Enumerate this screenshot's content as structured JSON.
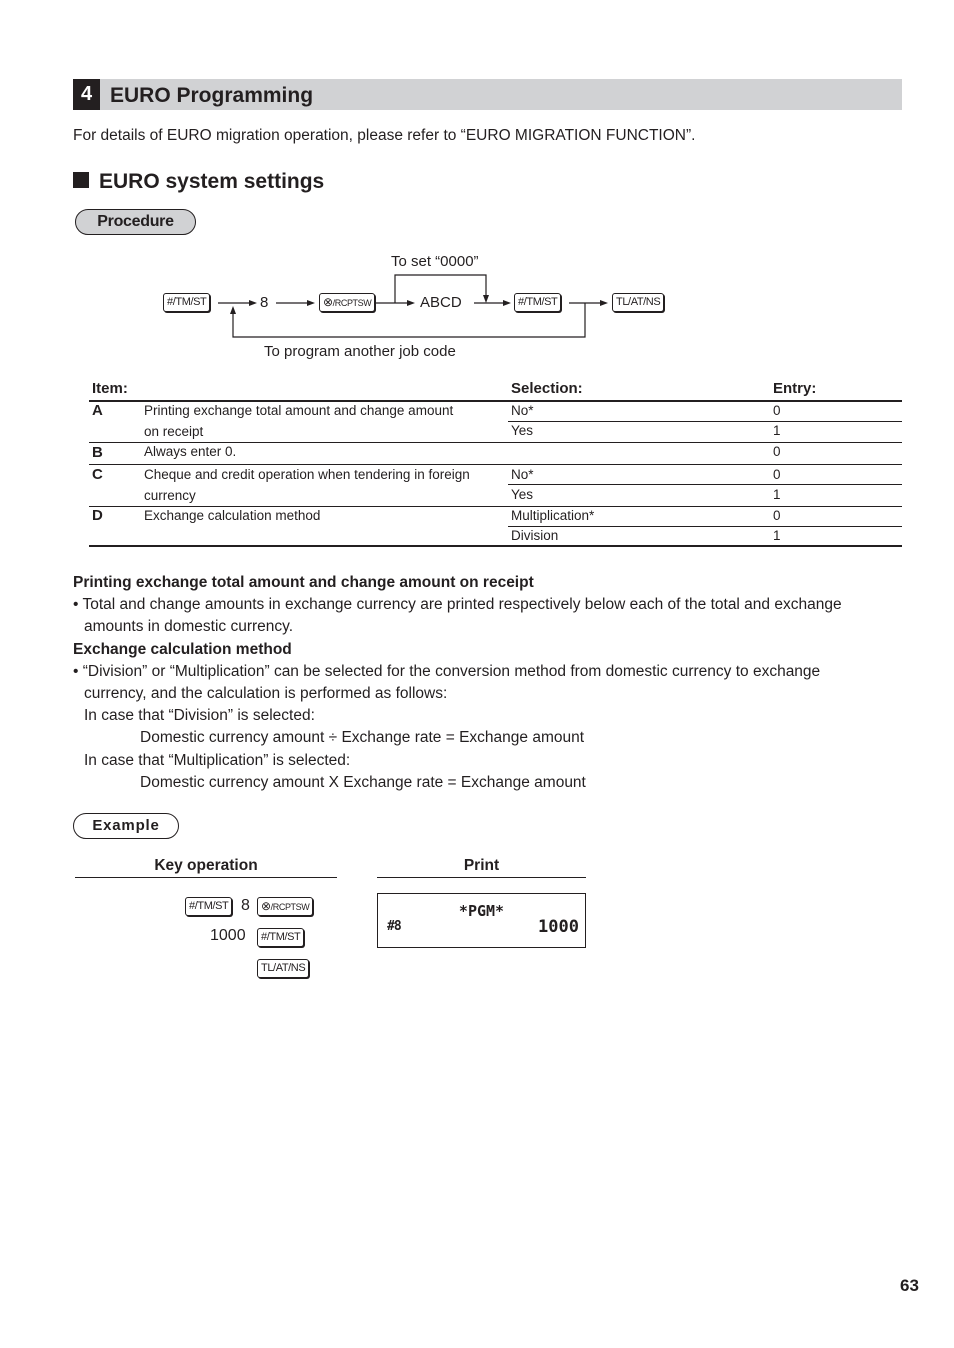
{
  "section": {
    "number": "4",
    "title": "EURO Programming",
    "intro": "For details of EURO migration operation, please refer to “EURO MIGRATION FUNCTION”."
  },
  "subsection": {
    "title": "EURO system settings",
    "procedure_label": "Procedure"
  },
  "flow": {
    "key1": "#/TM/ST",
    "digit": "8",
    "key2_symbol": "⊗",
    "key2_text": "/RCPTSW",
    "input": "ABCD",
    "key3": "#/TM/ST",
    "key4": "TL/AT/NS",
    "note_top": "To set “0000”",
    "note_bottom": "To program another job code"
  },
  "table": {
    "headers": {
      "item": "Item:",
      "selection": "Selection:",
      "entry": "Entry:"
    },
    "rows": [
      {
        "letter": "A",
        "desc1": "Printing exchange total amount and change amount",
        "desc2": "on receipt",
        "options": [
          {
            "selection": "No*",
            "entry": "0"
          },
          {
            "selection": "Yes",
            "entry": "1"
          }
        ]
      },
      {
        "letter": "B",
        "desc1": "Always enter 0.",
        "desc2": "",
        "options": [
          {
            "selection": "",
            "entry": "0"
          }
        ]
      },
      {
        "letter": "C",
        "desc1": "Cheque and credit operation when tendering in foreign",
        "desc2": "currency",
        "options": [
          {
            "selection": "No*",
            "entry": "0"
          },
          {
            "selection": "Yes",
            "entry": "1"
          }
        ]
      },
      {
        "letter": "D",
        "desc1": "Exchange calculation method",
        "desc2": "",
        "options": [
          {
            "selection": "Multiplication*",
            "entry": "0"
          },
          {
            "selection": "Division",
            "entry": "1"
          }
        ]
      }
    ]
  },
  "notes": {
    "h1": "Printing exchange total amount and change amount on receipt",
    "p1_line1": "• Total and change amounts in exchange currency are printed respectively below each of the total and exchange",
    "p1_line2": "amounts in domestic currency.",
    "h2": "Exchange calculation method",
    "p2_line1": "• “Division” or “Multiplication” can be selected for the conversion method from domestic currency to exchange",
    "p2_line2": "currency, and the calculation is performed as follows:",
    "p2_line3": "In case that “Division” is selected:",
    "p2_line4": "Domestic currency amount ÷ Exchange rate = Exchange amount",
    "p2_line5": "In case that “Multiplication” is selected:",
    "p2_line6": "Domestic currency amount X Exchange rate = Exchange amount"
  },
  "example": {
    "label": "Example",
    "key_operation_header": "Key operation",
    "print_header": "Print",
    "ops": {
      "line1_key1": "#/TM/ST",
      "line1_digit": "8",
      "line1_key2_symbol": "⊗",
      "line1_key2_text": "/RCPTSW",
      "line2_value": "1000",
      "line2_key": "#/TM/ST",
      "line3_key": "TL/AT/NS"
    },
    "print": {
      "title": "*PGM*",
      "left": "#8",
      "right": "1000"
    }
  },
  "page_number": "63"
}
